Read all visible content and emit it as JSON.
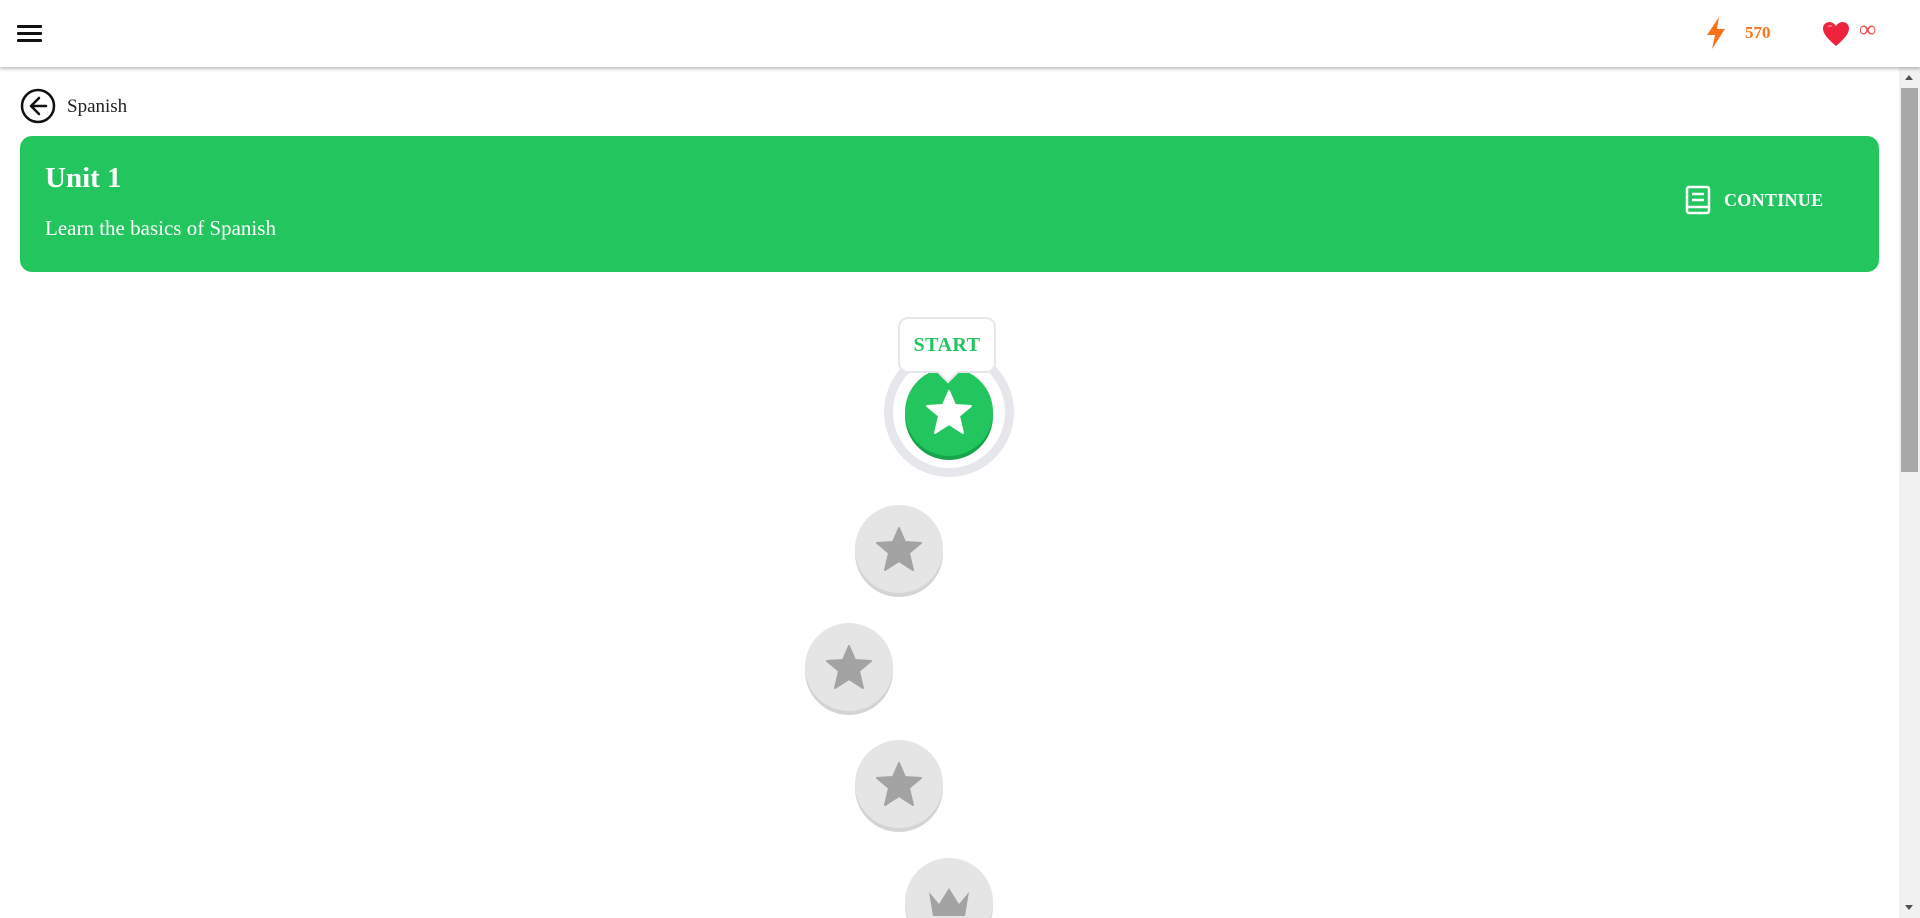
{
  "header": {
    "menu_icon": "hamburger-menu-icon",
    "xp_icon": "lightning-icon",
    "xp_count": "570",
    "lives_icon": "heart-icon",
    "lives": "∞",
    "colors": {
      "xp": "#f97316",
      "heart": "#ef4444"
    }
  },
  "nav": {
    "back_icon": "arrow-left-circle-icon",
    "course_name": "Spanish"
  },
  "unit": {
    "title": "Unit 1",
    "subtitle": "Learn the basics of Spanish",
    "continue_icon": "book-icon",
    "continue_label": "CONTINUE",
    "color": "#22c55e"
  },
  "path": {
    "start_label": "START",
    "lessons": [
      {
        "icon": "star-icon",
        "state": "active"
      },
      {
        "icon": "star-icon",
        "state": "locked"
      },
      {
        "icon": "star-icon",
        "state": "locked"
      },
      {
        "icon": "star-icon",
        "state": "locked"
      },
      {
        "icon": "crown-icon",
        "state": "locked"
      }
    ]
  }
}
